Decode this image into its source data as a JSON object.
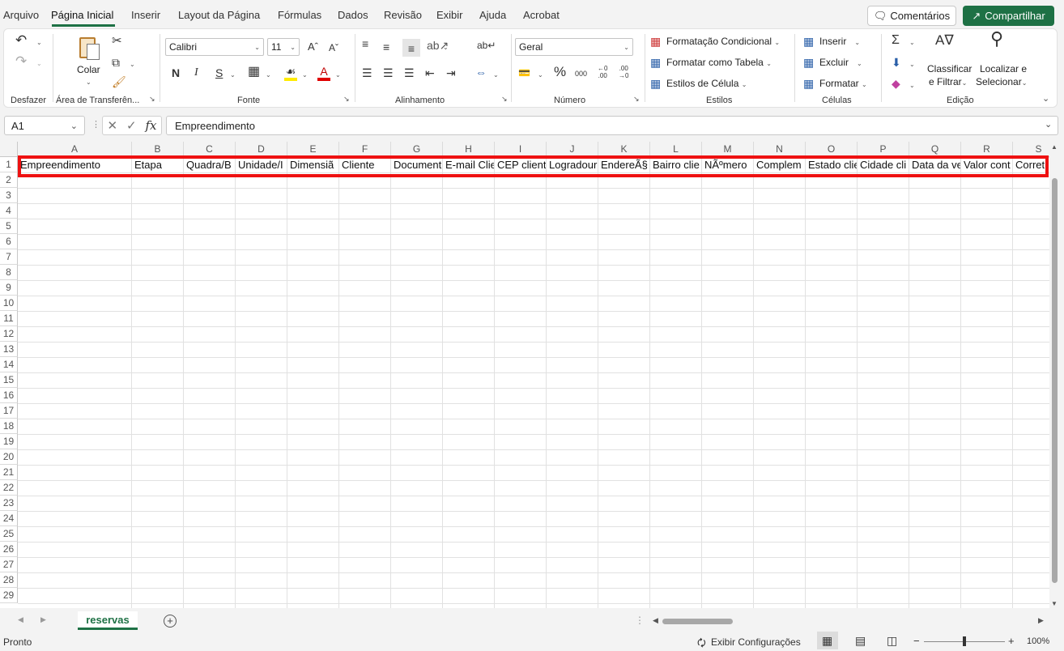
{
  "menu": {
    "tabs": [
      "Arquivo",
      "Página Inicial",
      "Inserir",
      "Layout da Página",
      "Fórmulas",
      "Dados",
      "Revisão",
      "Exibir",
      "Ajuda",
      "Acrobat"
    ],
    "comments_label": "Comentários",
    "share_label": "Compartilhar"
  },
  "ribbon": {
    "undo_group_label": "Desfazer",
    "clipboard": {
      "paste_label": "Colar",
      "group_label": "Área de Transferên..."
    },
    "font": {
      "name": "Calibri",
      "size": "11",
      "bold": "N",
      "italic": "I",
      "underline": "S",
      "group_label": "Fonte"
    },
    "alignment": {
      "group_label": "Alinhamento"
    },
    "number": {
      "format": "Geral",
      "group_label": "Número"
    },
    "styles": {
      "conditional": "Formatação Condicional",
      "as_table": "Formatar como Tabela",
      "cell_styles": "Estilos de Célula",
      "group_label": "Estilos"
    },
    "cells": {
      "insert": "Inserir",
      "delete": "Excluir",
      "format": "Formatar",
      "group_label": "Células"
    },
    "editing": {
      "sort_line1": "Classificar",
      "sort_line2": "e Filtrar",
      "find_line1": "Localizar e",
      "find_line2": "Selecionar",
      "group_label": "Edição"
    }
  },
  "formula_bar": {
    "cell_ref": "A1",
    "content": "Empreendimento"
  },
  "columns": [
    "A",
    "B",
    "C",
    "D",
    "E",
    "F",
    "G",
    "H",
    "I",
    "J",
    "K",
    "L",
    "M",
    "N",
    "O",
    "P",
    "Q",
    "R",
    "S"
  ],
  "rows": [
    "1",
    "2",
    "3",
    "4",
    "5",
    "6",
    "7",
    "8",
    "9",
    "10",
    "11",
    "12",
    "13",
    "14",
    "15",
    "16",
    "17",
    "18",
    "19",
    "20",
    "21",
    "22",
    "23",
    "24",
    "25",
    "26",
    "27",
    "28",
    "29"
  ],
  "row1": [
    "Empreendimento",
    "Etapa",
    "Quadra/B",
    "Unidade/I",
    "Dimensiã",
    "Cliente",
    "Document",
    "E-mail Clie",
    "CEP client",
    "Logradour",
    "EndereÃ§",
    "Bairro clie",
    "NÃºmero",
    "Complem",
    "Estado clie",
    "Cidade cli",
    "Data da ve",
    "Valor cont",
    "Corret"
  ],
  "sheet": {
    "name": "reservas"
  },
  "status": {
    "ready": "Pronto",
    "view_settings": "Exibir Configurações",
    "zoom": "100%"
  },
  "colors": {
    "accent": "#1e7145",
    "highlight": "#ee1111"
  }
}
